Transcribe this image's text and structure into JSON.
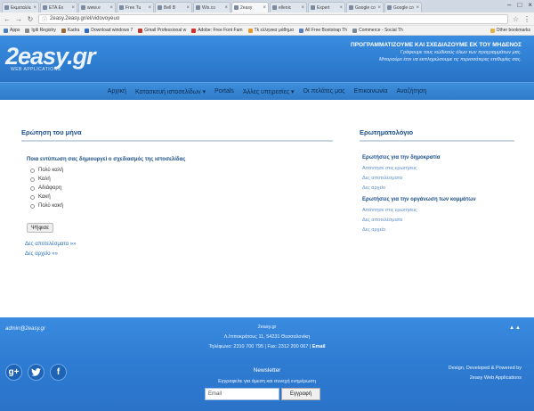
{
  "browser": {
    "tabs": [
      "Εκμεταλλε",
      "ETA Ex",
      "www.e",
      "Free Tu",
      "Bell B",
      "Wix.co",
      "2easy",
      "ellenic",
      "Expert",
      "Google co",
      "Google co"
    ],
    "active_tab_index": 6,
    "url": "2easy.2easy.gr/el/vidovoyeuo",
    "bookmarks": [
      "Apps",
      "Igiti Registry",
      "Kadra",
      "Download windows 7",
      "Gmail Professional w",
      "Adobe: Free Font Fam",
      "Tk ελληνικα μάθημα",
      "All Free Bootstrap Th",
      "Commerce - Social Th"
    ],
    "bookmark_right": "Other bookmarks",
    "bookmark_colors": [
      "#4a7fc1",
      "#8a8a8a",
      "#9a6a3a",
      "#2f6ac6",
      "#c0392b",
      "#d32f2f",
      "#e69a2e",
      "#5a7fbf",
      "#7a8a9a"
    ]
  },
  "site": {
    "logo": "2easy.gr",
    "logo_sub": "WEB APPLICATIONS",
    "tagline_1": "ΠΡΟΓΡΑΜΜΑΤΙΖΟΥΜΕ ΚΑΙ ΣΧΕΔΙΑΖΟΥΜΕ ΕΚ ΤΟΥ ΜΗΔΕΝΟΣ",
    "tagline_2": "Γράφουμε τους κώδικούς όλων των προγραμμάτων μας.",
    "tagline_3": "Μπορούμε έτσι να εκπληρώσουμε τις περισσότερες επιθυμίες σας."
  },
  "nav": [
    "Αρχική",
    "Κατασκευή ιστοσελίδων ▾",
    "Portals",
    "Άλλες υπηρεσίες ▾",
    "Οι πελάτες μας",
    "Επικοινωνία",
    "Αναζήτηση"
  ],
  "poll": {
    "title": "Ερώτηση του μήνα",
    "question": "Ποια εντύπωση σας δημιουργεί ο σχεδιασμός της ιστοσελίδας",
    "options": [
      "Πολύ καλή",
      "Καλή",
      "Αδιάφορη",
      "Κακή",
      "Πολύ κακή"
    ],
    "vote_button": "Ψήφισε",
    "results_link": "Δες αποτελέσματα »»",
    "archive_link": "Δες αρχείο »»"
  },
  "survey": {
    "title": "Ερωτηματολόγιο",
    "group1_title": "Ερωτήσεις για την δημοκρατία",
    "group1_links": [
      "Απάντησε στις ερωτήσεις",
      "Δες αποτελέσματα",
      "Δες αρχείο"
    ],
    "group2_title": "Ερωτήσεις για την οργάνωση των κομμάτων",
    "group2_links": [
      "Απάντησε στις ερωτήσεις",
      "Δες αποτελέσματα",
      "Δες αρχείο"
    ]
  },
  "footer": {
    "email": "admin@2easy.gr",
    "company": "2easy.gr",
    "address": "Λ.Ιπποκράτους 11, 54231 Θεσσαλονίκη",
    "phones": "Τηλέφωνο: 2310 700 795 | Fax: 2312 200 067 |",
    "email_link": "Email",
    "scroll_top": "▲▲",
    "social": [
      "g+",
      "t",
      "f"
    ],
    "newsletter_title": "Newsletter",
    "newsletter_sub": "Εγγραφείτε για άμεση και συνεχή ενημέρωση",
    "newsletter_placeholder": "Email",
    "newsletter_button": "Εγγραφή",
    "credit_1": "Design, Developed & Powered by",
    "credit_2": "2easy Web Applications"
  }
}
